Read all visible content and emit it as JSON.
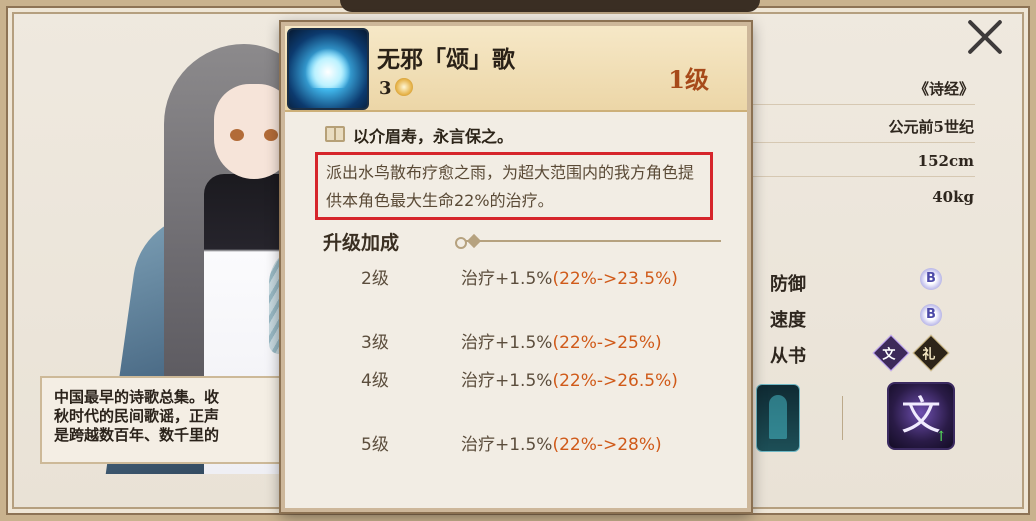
{
  "character": {
    "lore_lines": [
      "中国最早的诗歌总集。收",
      "秋时代的民间歌谣，正声",
      "是跨越数百年、数千里的"
    ]
  },
  "info": {
    "source": "《诗经》",
    "era": "公元前5世纪",
    "height": "152cm",
    "weight": "40kg"
  },
  "stats": {
    "defense_label": "防御",
    "defense_grade": "B",
    "speed_label": "速度",
    "speed_grade": "B",
    "series_label": "从书",
    "series_tag_1": "文",
    "series_tag_2": "礼"
  },
  "cards": {
    "wen_label": "文",
    "wen_arrow": "↑"
  },
  "skill": {
    "name": "无邪「颂」歌",
    "cost": "3",
    "level": "1级",
    "quote": "以介眉寿，永言保之。",
    "description": "派出水鸟散布疗愈之雨，为超大范围内的我方角色提供本角色最大生命22%的治疗。",
    "upgrade_title": "升级加成",
    "upgrades": [
      {
        "level": "2级",
        "effect": "治疗+1.5%",
        "change": "(22%->23.5%)"
      },
      {
        "level": "3级",
        "effect": "治疗+1.5%",
        "change": "(22%->25%)"
      },
      {
        "level": "4级",
        "effect": "治疗+1.5%",
        "change": "(22%->26.5%)"
      },
      {
        "level": "5级",
        "effect": "治疗+1.5%",
        "change": "(22%->28%)"
      }
    ]
  },
  "colors": {
    "highlight_border": "#d6252b",
    "upgrade_change": "#d05a19",
    "level_text": "#a74a1a"
  },
  "icons": {
    "close": "close-icon",
    "book": "book-icon",
    "skill": "water-bird-skill-icon",
    "cost": "cost-icon"
  }
}
